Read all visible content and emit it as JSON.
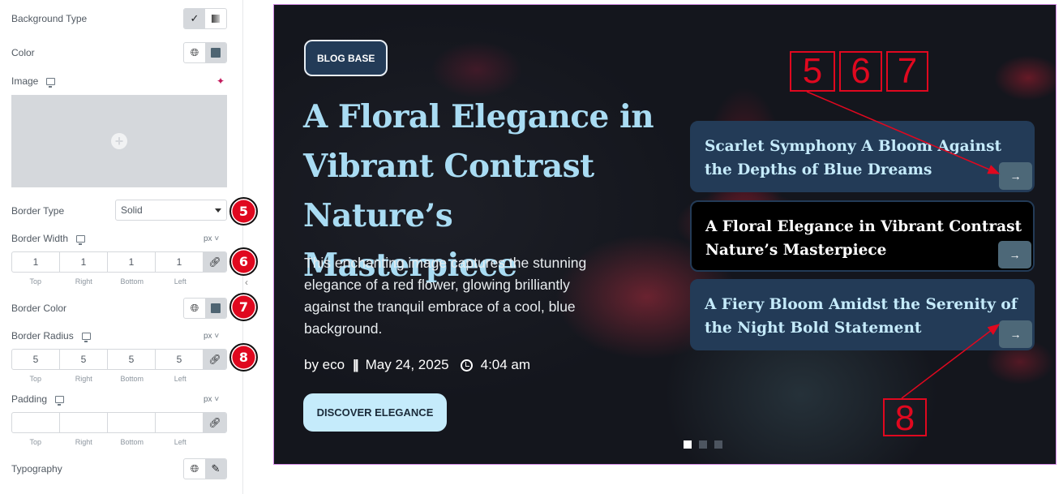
{
  "panel": {
    "background_type": {
      "label": "Background Type",
      "icon_paint": "brush-icon",
      "icon_gradient": "gradient-icon"
    },
    "color": {
      "label": "Color",
      "swatch_color": "#4e6472"
    },
    "image": {
      "label": "Image",
      "add_icon": "+"
    },
    "border_type": {
      "label": "Border Type",
      "value": "Solid"
    },
    "border_width": {
      "label": "Border Width",
      "unit": "px ˅",
      "values": [
        "1",
        "1",
        "1",
        "1"
      ]
    },
    "border_color": {
      "label": "Border Color",
      "swatch_color": "#4e6472"
    },
    "border_radius": {
      "label": "Border Radius",
      "unit": "px ˅",
      "values": [
        "5",
        "5",
        "5",
        "5"
      ]
    },
    "padding": {
      "label": "Padding",
      "unit": "px ˅",
      "values": [
        "",
        "",
        "",
        ""
      ]
    },
    "typography": {
      "label": "Typography"
    },
    "sides": [
      "Top",
      "Right",
      "Bottom",
      "Left"
    ],
    "badges": [
      "5",
      "6",
      "7",
      "8"
    ]
  },
  "slider": {
    "category": "BLOG BASE",
    "title": "A Floral Elegance in Vibrant Contrast Nature’s Masterpiece",
    "description": "This enchanting image captures the stunning elegance of a red flower, glowing brilliantly against the tranquil embrace of a cool, blue background.",
    "author": "by eco",
    "separator": "||",
    "date": "May 24, 2025",
    "time": "4:04 am",
    "button": "DISCOVER ELEGANCE",
    "cards": [
      {
        "title": "Scarlet Symphony A Bloom Against the Depths of Blue Dreams",
        "active": false
      },
      {
        "title": "A Floral Elegance in Vibrant Contrast Nature’s Masterpiece",
        "active": true
      },
      {
        "title": "A Fiery Bloom Amidst the Serenity of the Night Bold Statement",
        "active": false
      }
    ],
    "arrow_glyph": "→",
    "dots": 3
  },
  "annotations": {
    "box5": "5",
    "box6": "6",
    "box7": "7",
    "box8": "8"
  },
  "colors": {
    "accent_red": "#e0081f",
    "card_bg": "#233b57",
    "title_color": "#a9dcf3",
    "button_bg": "#c5ebfb"
  }
}
